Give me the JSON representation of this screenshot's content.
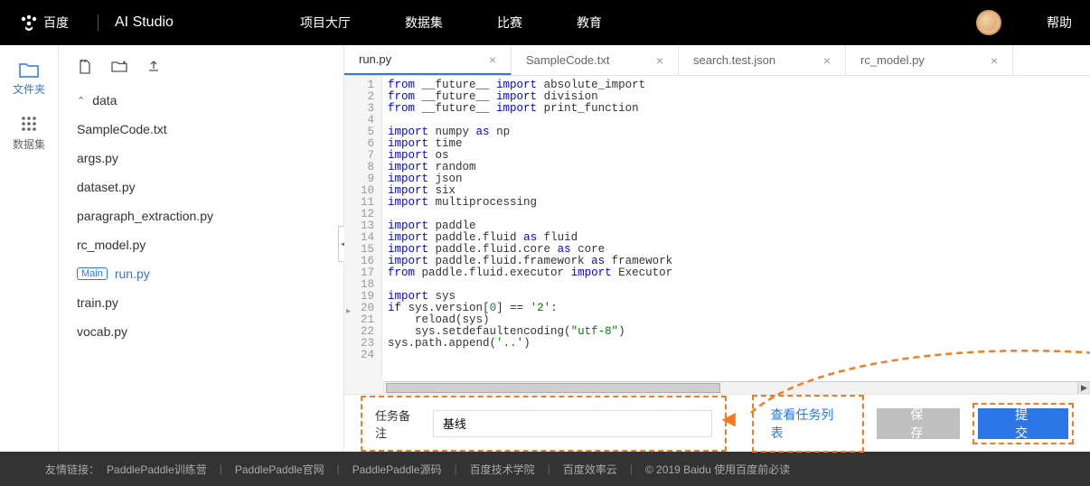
{
  "header": {
    "logo_text": "百度",
    "product": "AI Studio",
    "nav": [
      "项目大厅",
      "数据集",
      "比赛",
      "教育"
    ],
    "help": "帮助"
  },
  "leftnav": {
    "files": "文件夹",
    "datasets": "数据集"
  },
  "sidebar": {
    "folder": "data",
    "files": [
      "SampleCode.txt",
      "args.py",
      "dataset.py",
      "paragraph_extraction.py",
      "rc_model.py",
      "run.py",
      "train.py",
      "vocab.py"
    ],
    "main_badge": "Main",
    "selected_index": 5
  },
  "tabs": [
    {
      "label": "run.py",
      "active": true
    },
    {
      "label": "SampleCode.txt",
      "active": false
    },
    {
      "label": "search.test.json",
      "active": false
    },
    {
      "label": "rc_model.py",
      "active": false
    }
  ],
  "code_lines": [
    {
      "n": 1,
      "tokens": [
        [
          "kw",
          "from"
        ],
        [
          "",
          " __future__ "
        ],
        [
          "kw",
          "import"
        ],
        [
          "",
          " absolute_import"
        ]
      ]
    },
    {
      "n": 2,
      "tokens": [
        [
          "kw",
          "from"
        ],
        [
          "",
          " __future__ "
        ],
        [
          "kw",
          "import"
        ],
        [
          "",
          " division"
        ]
      ]
    },
    {
      "n": 3,
      "tokens": [
        [
          "kw",
          "from"
        ],
        [
          "",
          " __future__ "
        ],
        [
          "kw",
          "import"
        ],
        [
          "",
          " print_function"
        ]
      ]
    },
    {
      "n": 4,
      "tokens": []
    },
    {
      "n": 5,
      "tokens": [
        [
          "kw",
          "import"
        ],
        [
          "",
          " numpy "
        ],
        [
          "kw",
          "as"
        ],
        [
          "",
          " np"
        ]
      ]
    },
    {
      "n": 6,
      "tokens": [
        [
          "kw",
          "import"
        ],
        [
          "",
          " time"
        ]
      ]
    },
    {
      "n": 7,
      "tokens": [
        [
          "kw",
          "import"
        ],
        [
          "",
          " os"
        ]
      ]
    },
    {
      "n": 8,
      "tokens": [
        [
          "kw",
          "import"
        ],
        [
          "",
          " random"
        ]
      ]
    },
    {
      "n": 9,
      "tokens": [
        [
          "kw",
          "import"
        ],
        [
          "",
          " json"
        ]
      ]
    },
    {
      "n": 10,
      "tokens": [
        [
          "kw",
          "import"
        ],
        [
          "",
          " six"
        ]
      ]
    },
    {
      "n": 11,
      "tokens": [
        [
          "kw",
          "import"
        ],
        [
          "",
          " multiprocessing"
        ]
      ]
    },
    {
      "n": 12,
      "tokens": []
    },
    {
      "n": 13,
      "tokens": [
        [
          "kw",
          "import"
        ],
        [
          "",
          " paddle"
        ]
      ]
    },
    {
      "n": 14,
      "tokens": [
        [
          "kw",
          "import"
        ],
        [
          "",
          " paddle.fluid "
        ],
        [
          "kw",
          "as"
        ],
        [
          "",
          " fluid"
        ]
      ]
    },
    {
      "n": 15,
      "tokens": [
        [
          "kw",
          "import"
        ],
        [
          "",
          " paddle.fluid.core "
        ],
        [
          "kw",
          "as"
        ],
        [
          "",
          " core"
        ]
      ]
    },
    {
      "n": 16,
      "tokens": [
        [
          "kw",
          "import"
        ],
        [
          "",
          " paddle.fluid.framework "
        ],
        [
          "kw",
          "as"
        ],
        [
          "",
          " framework"
        ]
      ]
    },
    {
      "n": 17,
      "tokens": [
        [
          "kw",
          "from"
        ],
        [
          "",
          " paddle.fluid.executor "
        ],
        [
          "kw",
          "import"
        ],
        [
          "",
          " Executor"
        ]
      ]
    },
    {
      "n": 18,
      "tokens": []
    },
    {
      "n": 19,
      "tokens": [
        [
          "kw",
          "import"
        ],
        [
          "",
          " sys"
        ]
      ]
    },
    {
      "n": 20,
      "tokens": [
        [
          "kw",
          "if"
        ],
        [
          "",
          " sys.version["
        ],
        [
          "num",
          "0"
        ],
        [
          "",
          "] == "
        ],
        [
          "str",
          "'2'"
        ],
        [
          "",
          ":"
        ]
      ]
    },
    {
      "n": 21,
      "tokens": [
        [
          "",
          "    reload(sys)"
        ]
      ]
    },
    {
      "n": 22,
      "tokens": [
        [
          "",
          "    sys.setdefaultencoding("
        ],
        [
          "str",
          "\"utf-8\""
        ],
        [
          "",
          ")"
        ]
      ]
    },
    {
      "n": 23,
      "tokens": [
        [
          "",
          "sys.path.append("
        ],
        [
          "str",
          "'..'"
        ],
        [
          "",
          ")"
        ]
      ]
    },
    {
      "n": 24,
      "tokens": []
    }
  ],
  "task": {
    "label": "任务备注",
    "value": "基线",
    "view_list": "查看任务列表",
    "save": "保存",
    "submit": "提 交"
  },
  "footer": {
    "prefix": "友情链接：",
    "links": [
      "PaddlePaddle训练营",
      "PaddlePaddle官网",
      "PaddlePaddle源码",
      "百度技术学院",
      "百度效率云"
    ],
    "copyright": "© 2019 Baidu 使用百度前必读"
  },
  "colors": {
    "accent": "#2b77e8",
    "highlight": "#f47c20"
  }
}
